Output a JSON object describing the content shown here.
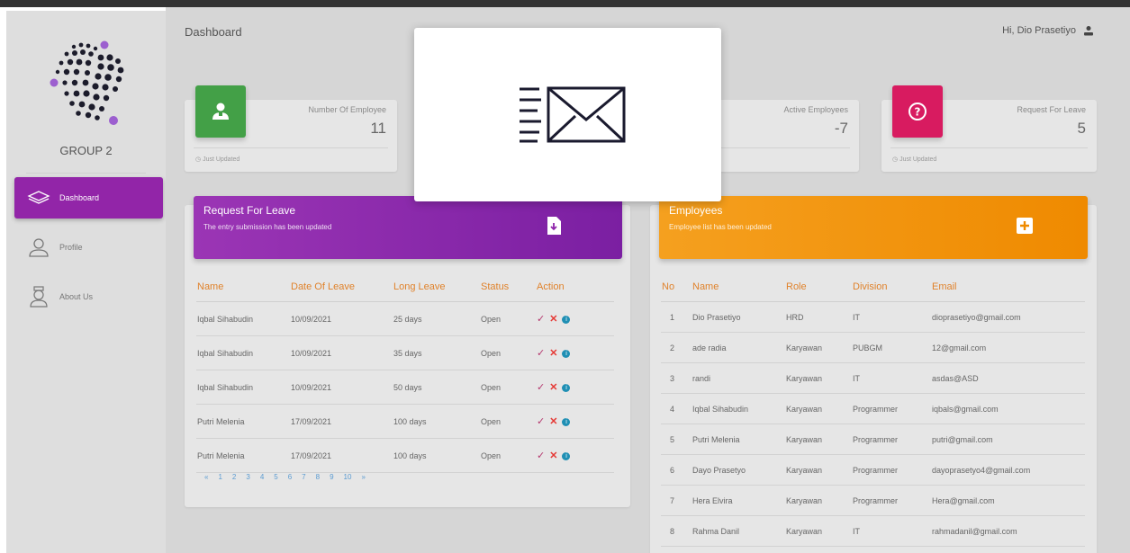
{
  "sidebar": {
    "group_name": "GROUP 2",
    "items": [
      {
        "label": "Dashboard",
        "icon": "layers-icon",
        "active": true
      },
      {
        "label": "Profile",
        "icon": "user-outline-icon",
        "active": false
      },
      {
        "label": "About Us",
        "icon": "person-avatar-icon",
        "active": false
      }
    ]
  },
  "header": {
    "breadcrumb": "Dashboard",
    "greeting": "Hi, Dio Prasetiyo",
    "user_icon": "person-icon"
  },
  "stats": [
    {
      "label": "Number Of Employee",
      "value": "11",
      "footer": "Just Updated",
      "icon": "employee-icon",
      "color": "#43a047"
    },
    {
      "label": "Active Employees",
      "value": "-7",
      "footer": "",
      "icon": "",
      "color": ""
    },
    {
      "label": "Request For Leave",
      "value": "5",
      "footer": "Just Updated",
      "icon": "question-icon",
      "color": "#d81b60"
    }
  ],
  "leave_panel": {
    "title": "Request For Leave",
    "subtitle": "The entry submission has been updated",
    "icon": "file-download-icon",
    "color": "#8e24aa",
    "columns": [
      "Name",
      "Date Of Leave",
      "Long Leave",
      "Status",
      "Action"
    ],
    "rows": [
      [
        "Iqbal Sihabudin",
        "10/09/2021",
        "25 days",
        "Open"
      ],
      [
        "Iqbal Sihabudin",
        "10/09/2021",
        "35 days",
        "Open"
      ],
      [
        "Iqbal Sihabudin",
        "10/09/2021",
        "50 days",
        "Open"
      ],
      [
        "Putri Melenia",
        "17/09/2021",
        "100 days",
        "Open"
      ],
      [
        "Putri Melenia",
        "17/09/2021",
        "100 days",
        "Open"
      ]
    ],
    "pagination": [
      "«",
      "1",
      "2",
      "3",
      "4",
      "5",
      "6",
      "7",
      "8",
      "9",
      "10",
      "»"
    ]
  },
  "employees_panel": {
    "title": "Employees",
    "subtitle": "Employee list has been updated",
    "icon": "plus-box-icon",
    "color": "#fb8c00",
    "columns": [
      "No",
      "Name",
      "Role",
      "Division",
      "Email"
    ],
    "rows": [
      [
        "1",
        "Dio Prasetiyo",
        "HRD",
        "IT",
        "dioprasetiyo@gmail.com"
      ],
      [
        "2",
        "ade radia",
        "Karyawan",
        "PUBGM",
        "12@gmail.com"
      ],
      [
        "3",
        "randi",
        "Karyawan",
        "IT",
        "asdas@ASD"
      ],
      [
        "4",
        "Iqbal Sihabudin",
        "Karyawan",
        "Programmer",
        "iqbals@gmail.com"
      ],
      [
        "5",
        "Putri Melenia",
        "Karyawan",
        "Programmer",
        "putri@gmail.com"
      ],
      [
        "6",
        "Dayo Prasetyo",
        "Karyawan",
        "Programmer",
        "dayoprasetyo4@gmail.com"
      ],
      [
        "7",
        "Hera Elvira",
        "Karyawan",
        "Programmer",
        "Hera@gmail.com"
      ],
      [
        "8",
        "Rahma Danil",
        "Karyawan",
        "IT",
        "rahmadanil@gmail.com"
      ]
    ]
  },
  "modal": {
    "icon": "fast-mail-icon"
  }
}
